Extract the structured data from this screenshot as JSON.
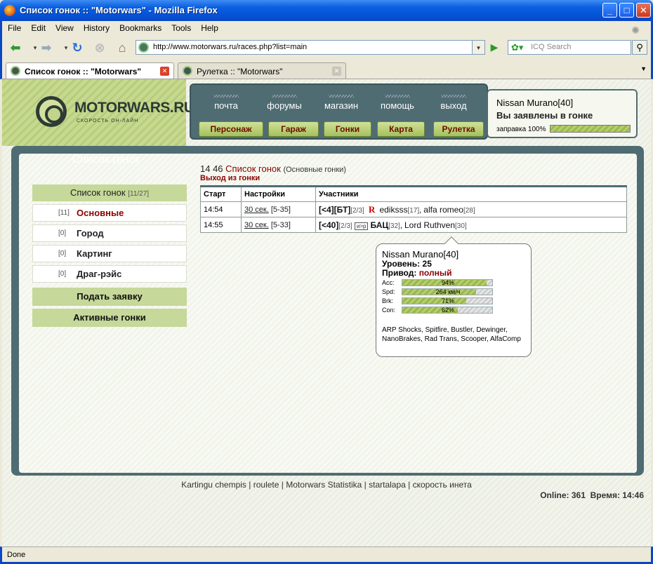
{
  "window": {
    "title": "Список гонок :: \"Motorwars\" - Mozilla Firefox",
    "minimize": "_",
    "maximize": "□",
    "close": "✕"
  },
  "menu": [
    "File",
    "Edit",
    "View",
    "History",
    "Bookmarks",
    "Tools",
    "Help"
  ],
  "navbar": {
    "url": "http://www.motorwars.ru/races.php?list=main",
    "search_placeholder": "ICQ Search"
  },
  "tabs": [
    {
      "label": "Список гонок :: \"Motorwars\"",
      "active": true
    },
    {
      "label": "Рулетка :: \"Motorwars\"",
      "active": false
    }
  ],
  "status": "Done",
  "site": {
    "logo_title": "MOTORWARS.RU",
    "logo_subtitle": "СКОРОСТЬ ОН-ЛАЙН",
    "nav_top": [
      "почта",
      "форумы",
      "магазин",
      "помощь",
      "выход"
    ],
    "nav_buttons": [
      "Персонаж",
      "Гараж",
      "Гонки",
      "Карта",
      "Рулетка"
    ],
    "user": {
      "car": "Nissan Murano[40]",
      "state": "Вы заявлены в гонке",
      "fuel_label": "заправка 100%",
      "fuel": 1.0
    }
  },
  "sidebar": {
    "heading": "Список гонок",
    "list_button": {
      "label": "Список гонок",
      "count": "[11/27]"
    },
    "items": [
      {
        "count": "[11]",
        "label": "Основные",
        "active": true
      },
      {
        "count": "[0]",
        "label": "Город",
        "active": false
      },
      {
        "count": "[0]",
        "label": "Картинг",
        "active": false
      },
      {
        "count": "[0]",
        "label": "Драг-рэйс",
        "active": false
      }
    ],
    "apply_button": "Подать заявку",
    "active_button": "Активные гонки"
  },
  "races": {
    "time": "14 46",
    "title": "Список гонок",
    "subtitle": "(Основные гонки)",
    "exit_link": "Выход из гонки",
    "columns": [
      "Старт",
      "Настройки",
      "Участники"
    ],
    "rows": [
      {
        "start": "14:54",
        "interval": "30 сек.",
        "range": "[5-35]",
        "cond": "[<4][БТ]",
        "slots": "[2/3]",
        "badge": "R",
        "participants": [
          {
            "name": "ediksss",
            "level": "[17]"
          },
          {
            "name": "alfa romeo",
            "level": "[28]"
          }
        ]
      },
      {
        "start": "14:55",
        "interval": "30 сек.",
        "range": "[5-33]",
        "cond": "[<40]",
        "slots": "[2/3]",
        "badge": "и>р",
        "participants": [
          {
            "name": "БАЦ",
            "level": "[32]"
          },
          {
            "name": "Lord Ruthven",
            "level": "[30]"
          }
        ]
      }
    ]
  },
  "tooltip": {
    "car": "Nissan Murano[40]",
    "level": "Уровень: 25",
    "drive_label": "Привод:",
    "drive_value": "полный",
    "stats": [
      {
        "label": "Acc:",
        "text": "94%",
        "value": 0.94
      },
      {
        "label": "Spd:",
        "text": "264 км/ч",
        "value": 0.82
      },
      {
        "label": "Brk:",
        "text": "71%",
        "value": 0.71
      },
      {
        "label": "Con:",
        "text": "62%",
        "value": 0.62
      }
    ],
    "parts": "ARP Shocks, Spitfire, Bustler, Dewinger, NanoBrakes, Rad Trans, Scooper, AlfaComp"
  },
  "footer": {
    "links": [
      "Kartingu chempis",
      "roulete",
      "Motorwars Statistika",
      "startalapa",
      "скорость инета"
    ],
    "online": "Online: 361",
    "time": "Время: 14:46"
  }
}
